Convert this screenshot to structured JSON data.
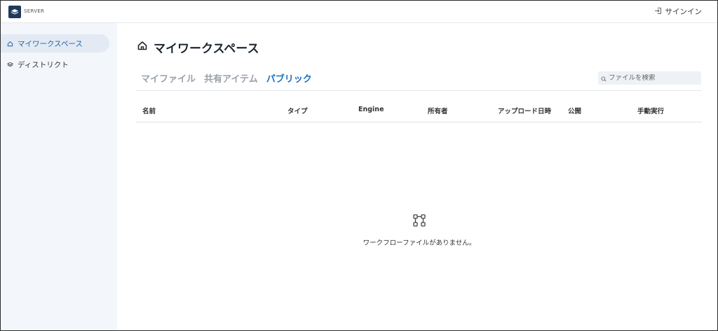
{
  "header": {
    "brand": "SERVER",
    "signin_label": "サインイン"
  },
  "sidebar": {
    "items": [
      {
        "label": "マイワークスペース",
        "icon": "home-icon",
        "active": true
      },
      {
        "label": "ディストリクト",
        "icon": "layers-icon",
        "active": false
      }
    ]
  },
  "main": {
    "title": "マイワークスペース",
    "tabs": [
      {
        "label": "マイファイル",
        "active": false
      },
      {
        "label": "共有アイテム",
        "active": false
      },
      {
        "label": "パブリック",
        "active": true
      }
    ],
    "search": {
      "placeholder": "ファイルを検索",
      "value": ""
    },
    "table": {
      "columns": [
        "名前",
        "タイプ",
        "Engine",
        "所有者",
        "アップロード日時",
        "公開",
        "手動実行"
      ]
    },
    "empty_message": "ワークフローファイルがありません。"
  },
  "colors": {
    "accent": "#1b6fc0",
    "sidebar_bg": "#f3f6fa",
    "sidebar_active_bg": "#e3eaf3",
    "logo_bg": "#1f3a5c"
  }
}
